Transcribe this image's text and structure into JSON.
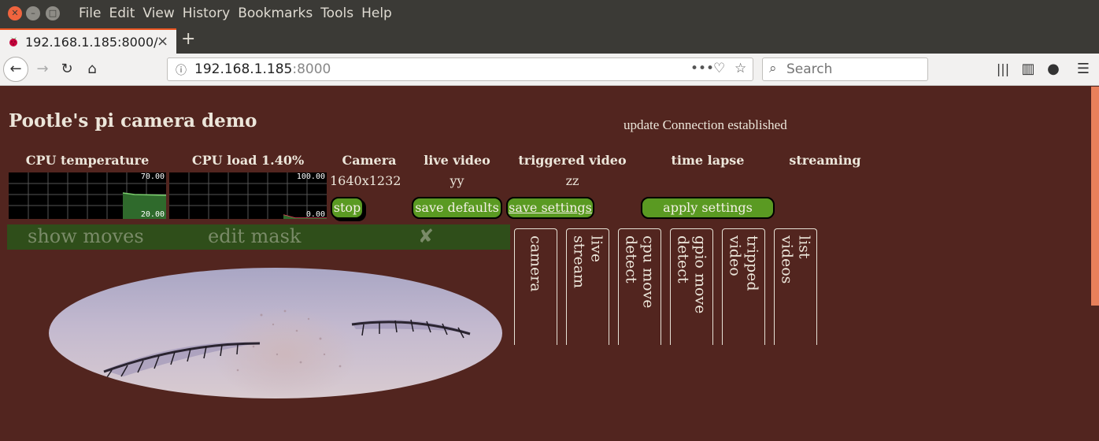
{
  "browser": {
    "menu": [
      "File",
      "Edit",
      "View",
      "History",
      "Bookmarks",
      "Tools",
      "Help"
    ],
    "tab_title": "192.168.1.185:8000/",
    "url_host": "192.168.1.185",
    "url_port": ":8000",
    "search_placeholder": "Search"
  },
  "page": {
    "title": "Pootle's pi camera demo",
    "status": "update Connection established",
    "columns": {
      "cpu_temp": "CPU temperature",
      "cpu_load": "CPU load 1.40%",
      "camera": "Camera",
      "live_video": "live video",
      "triggered_video": "triggered video",
      "time_lapse": "time lapse",
      "streaming": "streaming"
    },
    "values": {
      "camera": "1640x1232",
      "live_video": "yy",
      "triggered_video": "zz"
    },
    "temp_graph": {
      "max_label": "70.00",
      "min_label": "20.00"
    },
    "load_graph": {
      "max_label": "100.00",
      "min_label": "0.00"
    },
    "buttons": {
      "stop": "stop",
      "save_defaults": "save defaults",
      "save_settings": "save settings",
      "apply_settings": "apply settings"
    },
    "modebar": {
      "show_moves": "show moves",
      "edit_mask": "edit mask",
      "close": "✘"
    },
    "vertical_tabs": {
      "camera": "camera",
      "live_stream": "live\nstream",
      "cpu_move_detect": "cpu move\ndetect",
      "gpio_move_detect": "gpio move\ndetect",
      "tripped_video": "tripped\nvideo",
      "list_videos": "list\nvideos"
    }
  },
  "colors": {
    "page_bg": "#52251f",
    "button_green": "#5a9a22",
    "modebar_bg": "#2f4e1a",
    "scroll_thumb": "#e8805b",
    "accent": "#e95420"
  }
}
